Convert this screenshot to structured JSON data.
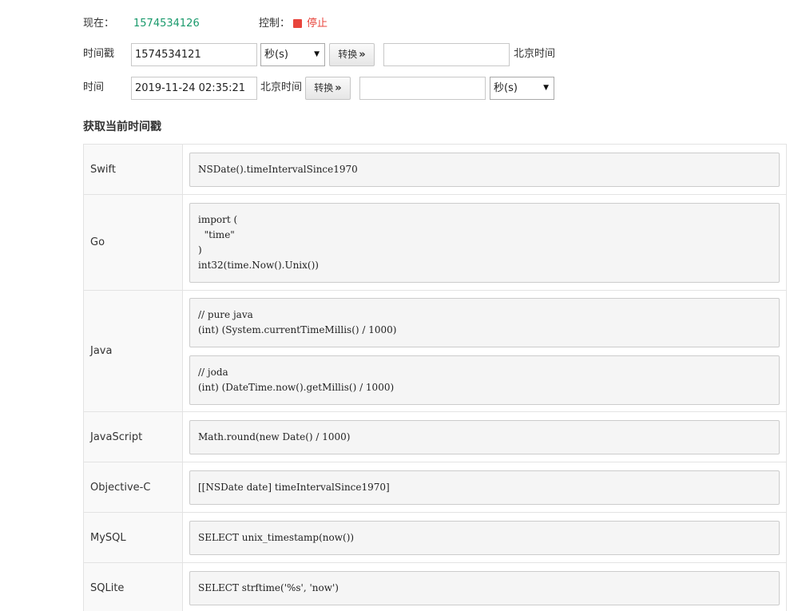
{
  "status": {
    "now_label": "现在：",
    "now_value": "1574534126",
    "control_label": "控制：",
    "stop_label": "停止",
    "stop_color": "#e8453c"
  },
  "timestamp_row": {
    "label": "时间戳",
    "input_value": "1574534121",
    "unit_selected": "秒(s)",
    "convert_label": "转换",
    "result_value": "",
    "result_suffix": "北京时间"
  },
  "datetime_row": {
    "label": "时间",
    "input_value": "2019-11-24 02:35:21",
    "input_suffix": "北京时间",
    "convert_label": "转换",
    "result_value": "",
    "unit_selected": "秒(s)"
  },
  "section": {
    "title": "获取当前时间戳"
  },
  "languages": [
    {
      "name": "Swift",
      "codes": [
        "NSDate().timeIntervalSince1970"
      ]
    },
    {
      "name": "Go",
      "codes": [
        "import (\n  \"time\"\n)\nint32(time.Now().Unix())"
      ]
    },
    {
      "name": "Java",
      "codes": [
        "// pure java\n(int) (System.currentTimeMillis() / 1000)",
        "// joda\n(int) (DateTime.now().getMillis() / 1000)"
      ]
    },
    {
      "name": "JavaScript",
      "codes": [
        "Math.round(new Date() / 1000)"
      ]
    },
    {
      "name": "Objective-C",
      "codes": [
        "[[NSDate date] timeIntervalSince1970]"
      ]
    },
    {
      "name": "MySQL",
      "codes": [
        "SELECT unix_timestamp(now())"
      ]
    },
    {
      "name": "SQLite",
      "codes": [
        "SELECT strftime('%s', 'now')"
      ]
    }
  ]
}
